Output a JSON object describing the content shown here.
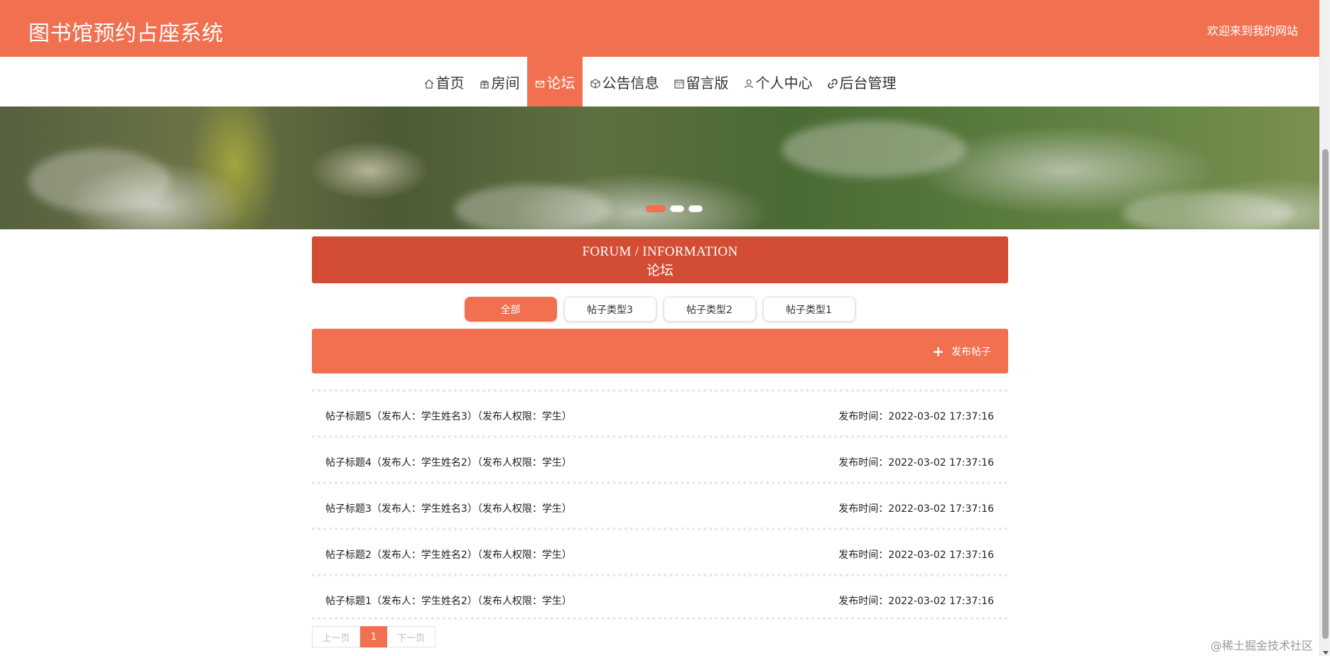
{
  "header": {
    "site_title": "图书馆预约占座系统",
    "welcome": "欢迎来到我的网站"
  },
  "nav": {
    "items": [
      {
        "label": "首页",
        "icon": "home-icon"
      },
      {
        "label": "房间",
        "icon": "gift-icon"
      },
      {
        "label": "论坛",
        "icon": "mail-icon",
        "active": true
      },
      {
        "label": "公告信息",
        "icon": "cube-icon"
      },
      {
        "label": "留言版",
        "icon": "calendar-icon"
      },
      {
        "label": "个人中心",
        "icon": "user-icon"
      },
      {
        "label": "后台管理",
        "icon": "link-icon"
      }
    ]
  },
  "banner": {
    "slides_count": 3,
    "active_slide": 1
  },
  "section": {
    "title_en": "FORUM / INFORMATION",
    "title_cn": "论坛"
  },
  "filters": [
    {
      "label": "全部",
      "active": true
    },
    {
      "label": "帖子类型3"
    },
    {
      "label": "帖子类型2"
    },
    {
      "label": "帖子类型1"
    }
  ],
  "post_bar": {
    "button_label": "发布帖子"
  },
  "posts": [
    {
      "title": "帖子标题5（发布人：学生姓名3）（发布人权限：学生）",
      "time": "发布时间：2022-03-02 17:37:16"
    },
    {
      "title": "帖子标题4（发布人：学生姓名2）（发布人权限：学生）",
      "time": "发布时间：2022-03-02 17:37:16"
    },
    {
      "title": "帖子标题3（发布人：学生姓名3）（发布人权限：学生）",
      "time": "发布时间：2022-03-02 17:37:16"
    },
    {
      "title": "帖子标题2（发布人：学生姓名2）（发布人权限：学生）",
      "time": "发布时间：2022-03-02 17:37:16"
    },
    {
      "title": "帖子标题1（发布人：学生姓名2）（发布人权限：学生）",
      "time": "发布时间：2022-03-02 17:37:16"
    }
  ],
  "pagination": {
    "prev": "上一页",
    "current": "1",
    "next": "下一页"
  },
  "watermark": "@稀土掘金技术社区",
  "colors": {
    "accent": "#f07050",
    "section_title_bg": "#d24d33"
  }
}
